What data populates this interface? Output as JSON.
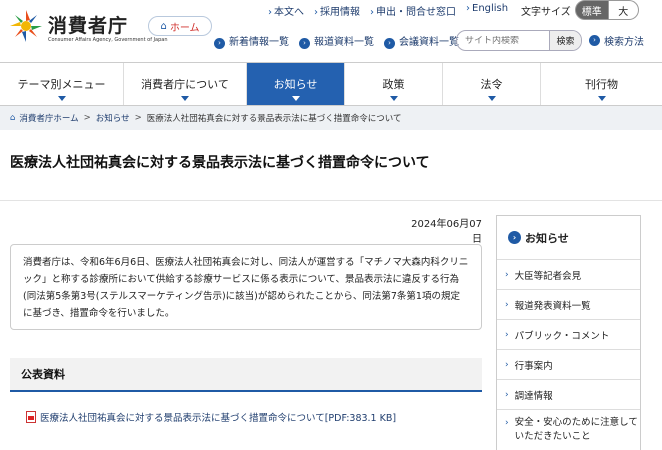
{
  "logo": {
    "title": "消費者庁",
    "subtitle": "Consumer Affairs Agency, Government of Japan"
  },
  "home": {
    "label": "ホーム"
  },
  "top_links": [
    "本文へ",
    "採用情報",
    "申出・問合せ窓口",
    "English"
  ],
  "font_size": {
    "label": "文字サイズ",
    "standard": "標準",
    "large": "大"
  },
  "sub_links": [
    "新着情報一覧",
    "報道資料一覧",
    "会議資料一覧"
  ],
  "search": {
    "placeholder": "サイト内検索",
    "button": "検索"
  },
  "howto": "検索方法",
  "nav": [
    "テーマ別メニュー",
    "消費者庁について",
    "お知らせ",
    "政策",
    "法令",
    "刊行物"
  ],
  "nav_active": "お知らせ",
  "breadcrumb": [
    "消費者庁ホーム",
    "お知らせ",
    "医療法人社団祐真会に対する景品表示法に基づく措置命令について"
  ],
  "page_title": "医療法人社団祐真会に対する景品表示法に基づく措置命令について",
  "date": "2024年06月07日",
  "summary": "消費者庁は、令和6年6月6日、医療法人社団祐真会に対し、同法人が運営する「マチノマ大森内科クリニック」と称する診療所において供給する診療サービスに係る表示について、景品表示法に違反する行為(同法第5条第3号(ステルスマーケティング告示)に該当)が認められたことから、同法第7条第1項の規定に基づき、措置命令を行いました。",
  "section_title": "公表資料",
  "pdf_link": "医療法人社団祐真会に対する景品表示法に基づく措置命令について[PDF:383.1 KB]",
  "sidebar": {
    "title": "お知らせ",
    "items": [
      "大臣等記者会見",
      "報道発表資料一覧",
      "パブリック・コメント",
      "行事案内",
      "調達情報",
      "安全・安心のために注意していただきたいこと"
    ]
  },
  "colors": {
    "accent": "#2461b0",
    "link": "#1f3d6e"
  }
}
